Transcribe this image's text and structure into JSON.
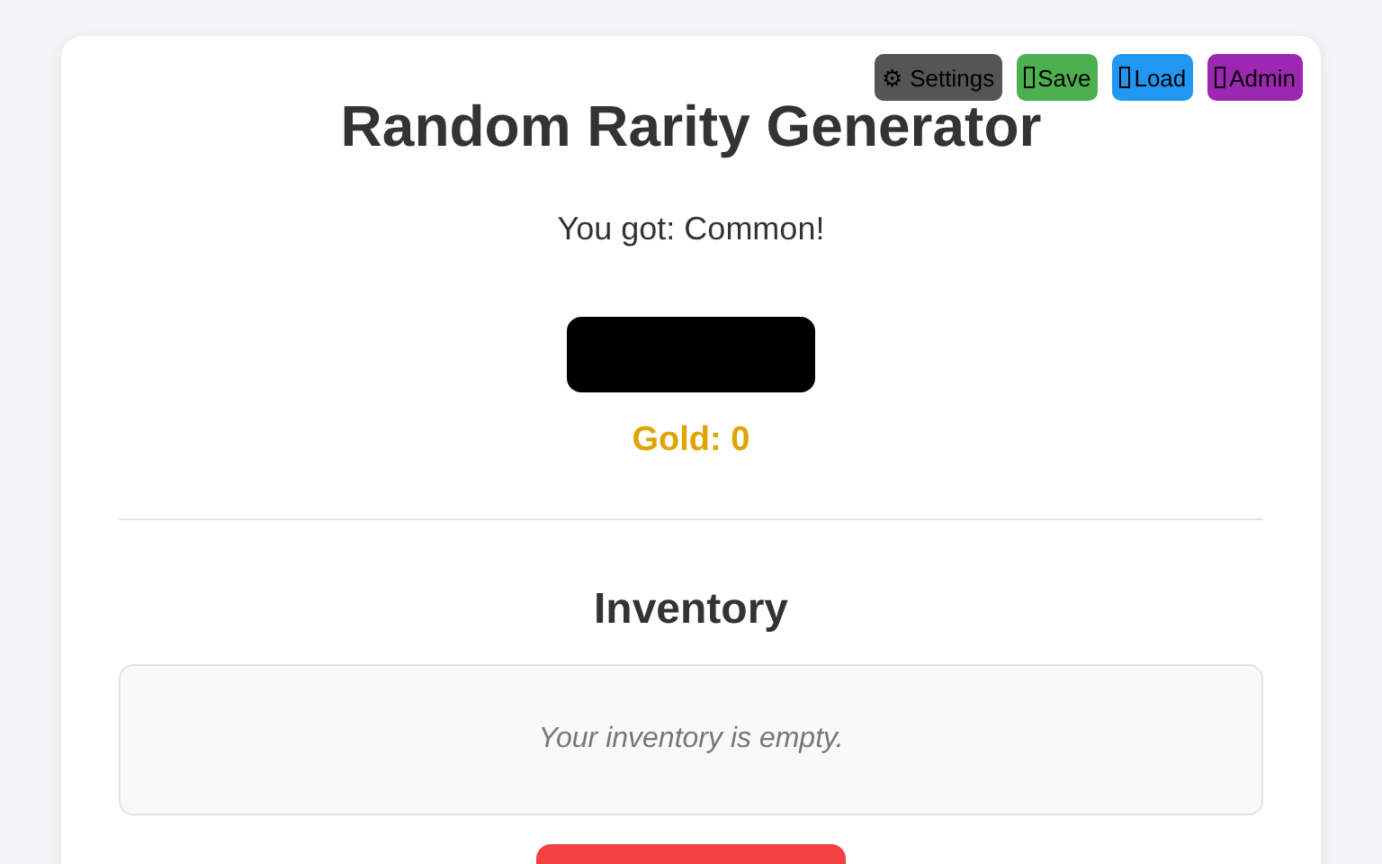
{
  "toolbar": [
    {
      "kind": "settings",
      "label": "⚙ Settings",
      "color": "#555555"
    },
    {
      "kind": "tofu",
      "label": "Save",
      "color": "#4caf50"
    },
    {
      "kind": "tofu",
      "label": "Load",
      "color": "#2196f3"
    },
    {
      "kind": "tofu",
      "label": "Admin",
      "color": "#9c27b0"
    }
  ],
  "title": "Random Rarity Generator",
  "result": "You got: Common!",
  "gold": "Gold: 0",
  "inventory": {
    "heading": "Inventory",
    "empty_message": "Your inventory is empty."
  }
}
